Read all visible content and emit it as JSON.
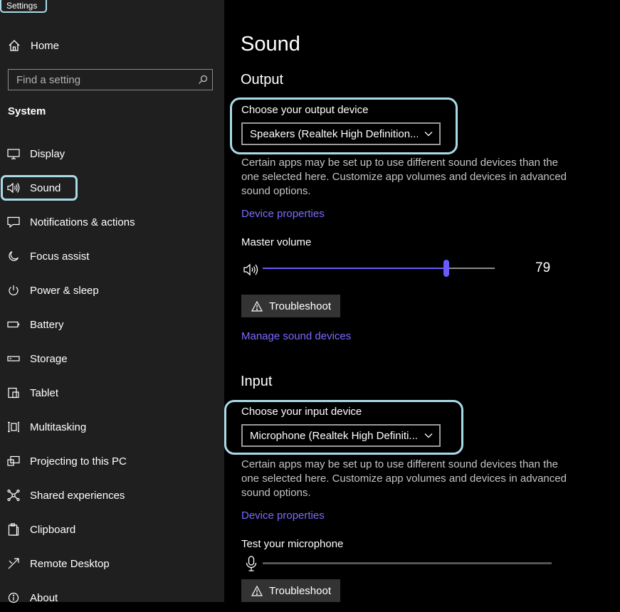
{
  "window": {
    "title": "Settings"
  },
  "sidebar": {
    "home_label": "Home",
    "search_placeholder": "Find a setting",
    "section_header": "System",
    "items": [
      {
        "label": "Display",
        "icon": "display-icon"
      },
      {
        "label": "Sound",
        "icon": "speaker-icon",
        "selected": true
      },
      {
        "label": "Notifications & actions",
        "icon": "notifications-icon"
      },
      {
        "label": "Focus assist",
        "icon": "moon-icon"
      },
      {
        "label": "Power & sleep",
        "icon": "power-icon"
      },
      {
        "label": "Battery",
        "icon": "battery-icon"
      },
      {
        "label": "Storage",
        "icon": "storage-icon"
      },
      {
        "label": "Tablet",
        "icon": "tablet-icon"
      },
      {
        "label": "Multitasking",
        "icon": "multitasking-icon"
      },
      {
        "label": "Projecting to this PC",
        "icon": "projecting-icon"
      },
      {
        "label": "Shared experiences",
        "icon": "shared-icon"
      },
      {
        "label": "Clipboard",
        "icon": "clipboard-icon"
      },
      {
        "label": "Remote Desktop",
        "icon": "remote-desktop-icon"
      },
      {
        "label": "About",
        "icon": "info-icon"
      }
    ]
  },
  "main": {
    "title": "Sound",
    "output": {
      "heading": "Output",
      "device_label": "Choose your output device",
      "device_value": "Speakers (Realtek High Definition...",
      "description": "Certain apps may be set up to use different sound devices than the one selected here. Customize app volumes and devices in advanced sound options.",
      "device_properties_link": "Device properties",
      "master_volume_label": "Master volume",
      "volume": 79,
      "troubleshoot_label": "Troubleshoot",
      "manage_link": "Manage sound devices"
    },
    "input": {
      "heading": "Input",
      "device_label": "Choose your input device",
      "device_value": "Microphone (Realtek High Definiti...",
      "description": "Certain apps may be set up to use different sound devices than the one selected here. Customize app volumes and devices in advanced sound options.",
      "device_properties_link": "Device properties",
      "test_label": "Test your microphone",
      "mic_level": 0,
      "troubleshoot_label": "Troubleshoot"
    }
  },
  "colors": {
    "accent": "#6a5bff",
    "link": "#7b6bff",
    "highlight": "#a8dbe8",
    "sidebar_bg": "#1f1f1f",
    "main_bg": "#000000"
  }
}
